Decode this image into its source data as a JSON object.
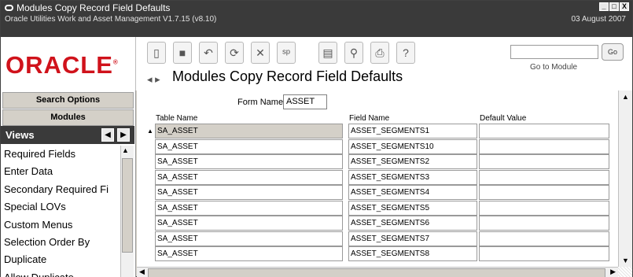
{
  "window": {
    "title": "Modules Copy Record Field Defaults",
    "subtitle": "Oracle Utilities Work and Asset Management V1.7.15 (v8.10)",
    "date": "03 August  2007",
    "minimize": "_",
    "maximize": "□",
    "close": "X"
  },
  "header": {
    "logo": "ORACLE",
    "goto_label": "Go to Module",
    "go_button": "Go",
    "goto_value": "",
    "form_title": "Modules Copy Record Field Defaults",
    "toolbar_icons": [
      "new-icon",
      "save-icon",
      "undo-icon",
      "refresh-icon",
      "delete-icon",
      "spellcheck-icon",
      "report-icon",
      "routing-icon",
      "print-icon",
      "help-icon"
    ]
  },
  "left": {
    "search_options": "Search Options",
    "modules": "Modules",
    "views_label": "Views",
    "views": [
      "Required Fields",
      "Enter Data",
      "Secondary Required Fi",
      "Special LOVs",
      "Custom Menus",
      "Selection Order By",
      "Duplicate",
      "Allow Duplicate"
    ]
  },
  "form": {
    "form_name_label": "Form Name",
    "form_name_value": "ASSET",
    "columns": {
      "table_name": "Table Name",
      "field_name": "Field Name",
      "default_value": "Default Value"
    },
    "rows": [
      {
        "table": "SA_ASSET",
        "field": "ASSET_SEGMENTS1",
        "default": ""
      },
      {
        "table": "SA_ASSET",
        "field": "ASSET_SEGMENTS10",
        "default": ""
      },
      {
        "table": "SA_ASSET",
        "field": "ASSET_SEGMENTS2",
        "default": ""
      },
      {
        "table": "SA_ASSET",
        "field": "ASSET_SEGMENTS3",
        "default": ""
      },
      {
        "table": "SA_ASSET",
        "field": "ASSET_SEGMENTS4",
        "default": ""
      },
      {
        "table": "SA_ASSET",
        "field": "ASSET_SEGMENTS5",
        "default": ""
      },
      {
        "table": "SA_ASSET",
        "field": "ASSET_SEGMENTS6",
        "default": ""
      },
      {
        "table": "SA_ASSET",
        "field": "ASSET_SEGMENTS7",
        "default": ""
      },
      {
        "table": "SA_ASSET",
        "field": "ASSET_SEGMENTS8",
        "default": ""
      }
    ]
  }
}
